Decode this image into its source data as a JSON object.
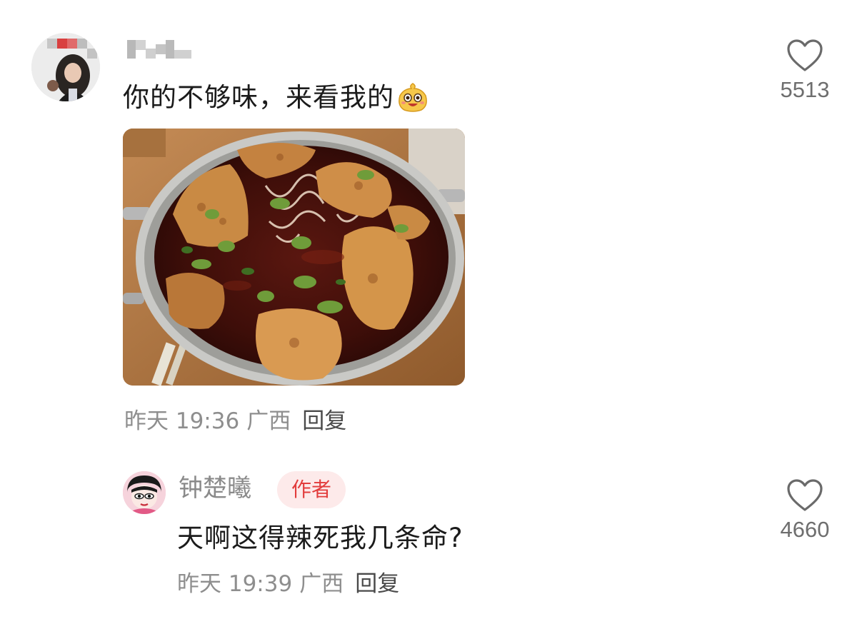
{
  "comment": {
    "text": "你的不够味，来看我的",
    "emoji": "smiling-bun-emoji",
    "date": "昨天",
    "time": "19:36",
    "location": "广西",
    "reply_label": "回复",
    "likes": "5513"
  },
  "reply": {
    "author": "钟楚曦",
    "badge": "作者",
    "text": "天啊这得辣死我几条命?",
    "date": "昨天",
    "time": "19:39",
    "location": "广西",
    "reply_label": "回复",
    "likes": "4660"
  },
  "colors": {
    "text_primary": "#1b1b1b",
    "text_meta": "#8e8e8e",
    "badge_bg": "#fdeaea",
    "badge_text": "#e23c3c"
  }
}
